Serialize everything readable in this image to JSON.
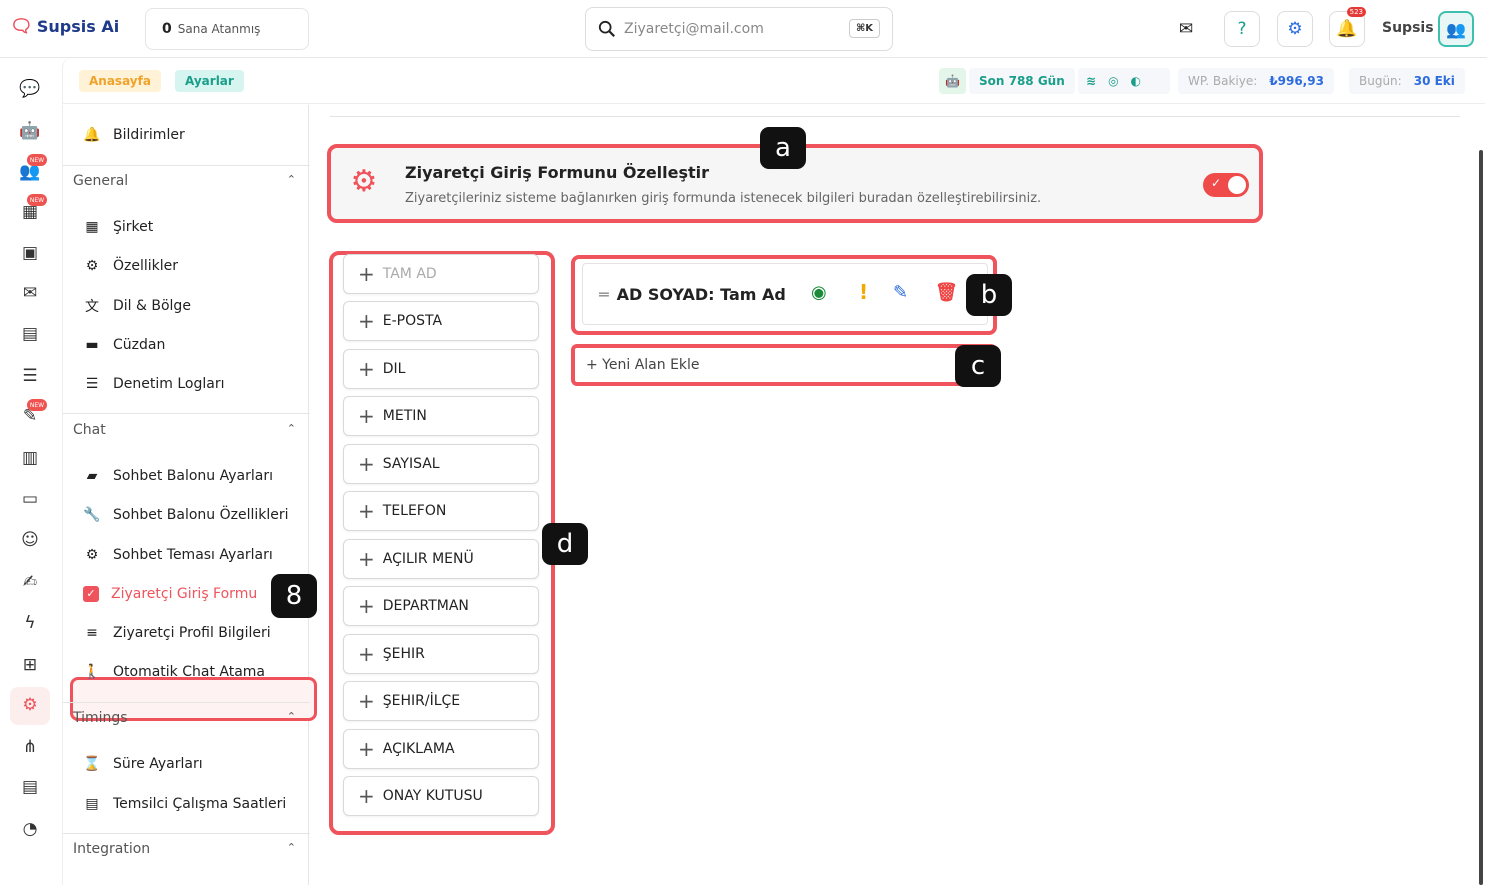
{
  "topbar": {
    "logo": "Supsis Ai",
    "assigned_count": "0",
    "assigned_label": "Sana Atanmış",
    "search_placeholder": "Ziyaretçi@mail.com",
    "search_kbd": "⌘K",
    "notif_count": "523",
    "user_name": "Supsis"
  },
  "breadcrumb": {
    "home": "Anasayfa",
    "settings": "Ayarlar"
  },
  "status": {
    "days": "Son 788 Gün",
    "wp_label": "WP. Bakiye:",
    "wp_value": "₺996,93",
    "today_label": "Bugün:",
    "today_value": "30 Eki"
  },
  "rail": {
    "new_badge": "NEW"
  },
  "sidebar": {
    "top_item": "Bildirimler",
    "general_header": "General",
    "general_items": [
      "Şirket",
      "Özellikler",
      "Dil & Bölge",
      "Cüzdan",
      "Denetim Logları"
    ],
    "chat_header": "Chat",
    "chat_items": [
      "Sohbet Balonu Ayarları",
      "Sohbet Balonu Özellikleri",
      "Sohbet Teması Ayarları",
      "Ziyaretçi Giriş Formu",
      "Ziyaretçi Profil Bilgileri",
      "Otomatik Chat Atama"
    ],
    "timings_header": "Timings",
    "timings_items": [
      "Süre Ayarları",
      "Temsilci Çalışma Saatleri"
    ],
    "integration_header": "Integration"
  },
  "form": {
    "title": "Ziyaretçi Giriş Formunu Özelleştir",
    "description": "Ziyaretçileriniz sisteme bağlanırken giriş formunda istenecek bilgileri buradan özelleştirebilirsiniz.",
    "enabled": true,
    "field_types": [
      "TAM AD",
      "E-POSTA",
      "DIL",
      "METIN",
      "SAYISAL",
      "TELEFON",
      "AÇILIR MENÜ",
      "DEPARTMAN",
      "ŞEHIR",
      "ŞEHIR/İLÇE",
      "AÇIKLAMA",
      "ONAY KUTUSU"
    ],
    "active_field": "AD SOYAD: Tam Ad",
    "add_field": "+ Yeni Alan Ekle"
  },
  "markers": {
    "a": "a",
    "b": "b",
    "c": "c",
    "d": "d",
    "step": "8"
  },
  "colors": {
    "accent": "#ef535c",
    "brand": "#1f3a8a",
    "teal": "#1a9e8a"
  }
}
